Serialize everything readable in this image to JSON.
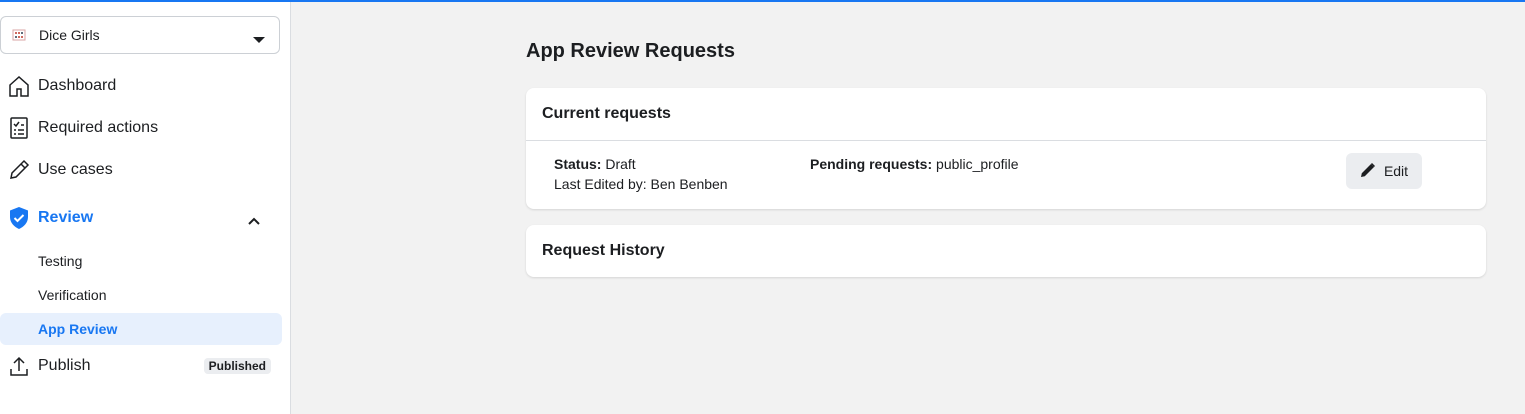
{
  "app_selector": {
    "name": "Dice Girls"
  },
  "nav": {
    "dashboard": "Dashboard",
    "required_actions": "Required actions",
    "use_cases": "Use cases",
    "review": "Review",
    "review_sub": [
      "Testing",
      "Verification",
      "App Review"
    ],
    "publish": "Publish",
    "publish_badge": "Published"
  },
  "main": {
    "title": "App Review Requests",
    "current_requests": {
      "header": "Current requests",
      "status_label": "Status:",
      "status_value": "Draft",
      "last_edited_label": "Last Edited by:",
      "last_edited_value": "Ben Benben",
      "pending_label": "Pending requests:",
      "pending_value": "public_profile",
      "edit_label": "Edit"
    },
    "request_history": {
      "header": "Request History"
    }
  },
  "colors": {
    "accent": "#1877f2",
    "selected_bg": "#e7f0fd",
    "page_bg": "#f2f2f2"
  },
  "icons": [
    "app-icon",
    "caret-down-icon",
    "home-icon",
    "checklist-icon",
    "pencil-icon",
    "shield-check-icon",
    "chevron-up-icon",
    "upload-icon",
    "edit-pencil-icon"
  ]
}
